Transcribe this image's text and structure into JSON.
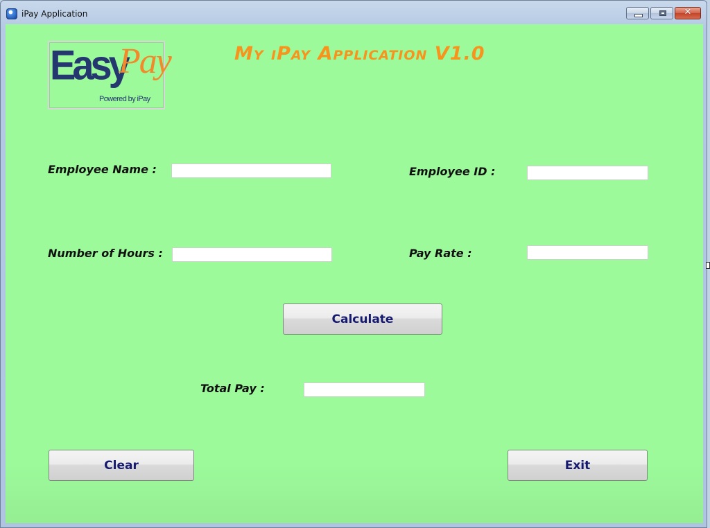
{
  "window": {
    "title": "iPay Application",
    "icon": "app-globe-icon",
    "controls": {
      "minimize": "minimize-icon",
      "maximize": "maximize-icon",
      "close": "close-icon",
      "close_glyph": "✕"
    }
  },
  "logo": {
    "easy": "Easy",
    "pay": "Pay",
    "tagline": "Powered by iPay"
  },
  "heading": "My iPay Application V1.0",
  "form": {
    "employee_name": {
      "label": "Employee Name :",
      "value": ""
    },
    "employee_id": {
      "label": "Employee ID :",
      "value": ""
    },
    "number_of_hours": {
      "label": "Number of Hours :",
      "value": ""
    },
    "pay_rate": {
      "label": "Pay Rate :",
      "value": ""
    },
    "total_pay": {
      "label": "Total Pay :",
      "value": ""
    }
  },
  "buttons": {
    "calculate": "Calculate",
    "clear": "Clear",
    "exit": "Exit"
  },
  "colors": {
    "background": "#9cfa9b",
    "heading": "#f7941d",
    "button_text": "#161a6e",
    "logo_blue": "#24386f",
    "logo_orange": "#f28a2c"
  }
}
